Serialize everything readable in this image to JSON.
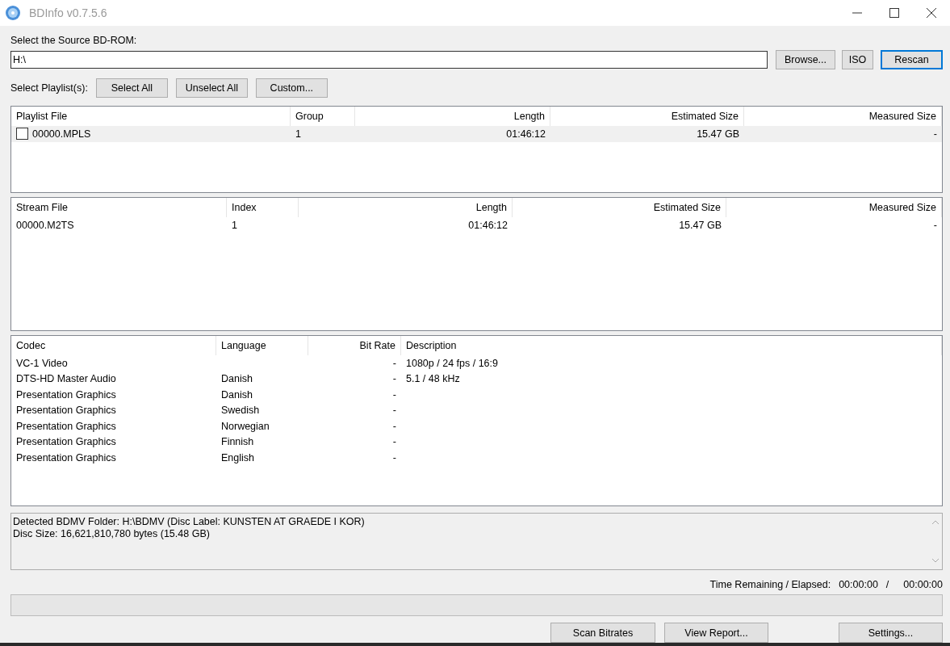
{
  "window": {
    "title": "BDInfo v0.7.5.6"
  },
  "source": {
    "label": "Select the Source BD-ROM:",
    "value": "H:\\",
    "buttons": [
      {
        "label": "Browse...",
        "focused": false
      },
      {
        "label": "ISO",
        "focused": false
      },
      {
        "label": "Rescan",
        "focused": true
      }
    ]
  },
  "playlist_select": {
    "label": "Select Playlist(s):",
    "buttons": [
      "Select All",
      "Unselect All",
      "Custom..."
    ]
  },
  "playlist_table": {
    "columns": [
      "Playlist File",
      "Group",
      "Length",
      "Estimated Size",
      "Measured Size"
    ],
    "rows": [
      {
        "cells": [
          "00000.MPLS",
          "1",
          "01:46:12",
          "15.47 GB",
          "-"
        ],
        "checked": false,
        "selected": true
      }
    ]
  },
  "stream_table": {
    "columns": [
      "Stream File",
      "Index",
      "Length",
      "Estimated Size",
      "Measured Size"
    ],
    "rows": [
      {
        "cells": [
          "00000.M2TS",
          "1",
          "01:46:12",
          "15.47 GB",
          "-"
        ]
      }
    ]
  },
  "codec_table": {
    "columns": [
      "Codec",
      "Language",
      "Bit Rate",
      "Description"
    ],
    "rows": [
      {
        "cells": [
          "VC-1 Video",
          "",
          "-",
          "1080p / 24 fps / 16:9"
        ]
      },
      {
        "cells": [
          "DTS-HD Master Audio",
          "Danish",
          "-",
          "5.1 / 48 kHz"
        ]
      },
      {
        "cells": [
          "Presentation Graphics",
          "Danish",
          "-",
          ""
        ]
      },
      {
        "cells": [
          "Presentation Graphics",
          "Swedish",
          "-",
          ""
        ]
      },
      {
        "cells": [
          "Presentation Graphics",
          "Norwegian",
          "-",
          ""
        ]
      },
      {
        "cells": [
          "Presentation Graphics",
          "Finnish",
          "-",
          ""
        ]
      },
      {
        "cells": [
          "Presentation Graphics",
          "English",
          "-",
          ""
        ]
      }
    ]
  },
  "log": {
    "lines": [
      "Detected BDMV Folder: H:\\BDMV (Disc Label: KUNSTEN AT GRAEDE I KOR)",
      "Disc Size: 16,621,810,780 bytes (15.48 GB)"
    ]
  },
  "timer": {
    "label": "Time Remaining / Elapsed:",
    "remaining": "00:00:00",
    "separator": "/",
    "elapsed": "00:00:00"
  },
  "progress": {
    "level": 0
  },
  "bottom_buttons": [
    "Scan Bitrates",
    "View Report...",
    "Settings..."
  ]
}
